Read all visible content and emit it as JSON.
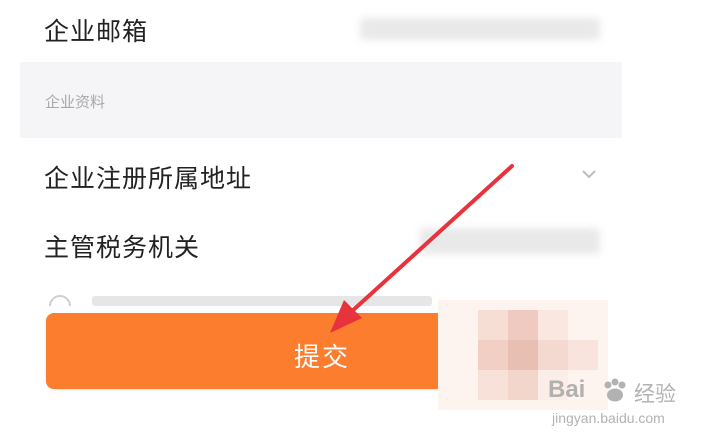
{
  "form": {
    "email_label": "企业邮箱",
    "section_title": "企业资料",
    "address_label": "企业注册所属地址",
    "tax_label": "主管税务机关"
  },
  "submit": {
    "label": "提交"
  },
  "watermark": {
    "brand": "Bai",
    "brand_cn": "经验",
    "url": "jingyan.baidu.com"
  },
  "colors": {
    "accent": "#fb7d2d",
    "arrow": "#e8323c",
    "section_bg": "#f5f5f7"
  },
  "icons": [
    "chevron-down-icon",
    "radio-icon",
    "arrow-annotation",
    "paw-icon"
  ]
}
